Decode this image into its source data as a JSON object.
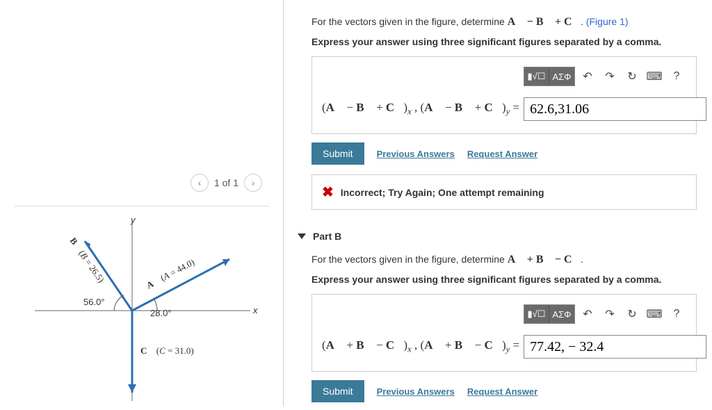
{
  "pager": {
    "label": "1 of 1"
  },
  "figure": {
    "y_label": "y",
    "x_label": "x",
    "angle_left": "56.0°",
    "angle_right": "28.0°",
    "vec_b": "B (B = 26.5)",
    "vec_a": "A (A = 44.0)",
    "vec_c": "C (C = 31.0)",
    "arrow_b": "↗",
    "arrow_a": "↗",
    "arrow_c": "↓",
    "b_prefix": "B⃗",
    "a_prefix": "A⃗",
    "c_prefix": "C⃗"
  },
  "partA": {
    "prompt_pre": "For the vectors given in the figure, determine ",
    "expr": "A⃗ − B⃗ + C⃗",
    "fig_ref": "(Figure 1)",
    "instruction": "Express your answer using three significant figures separated by a comma.",
    "toolbar": {
      "template": "▮√☐",
      "greek": "ΑΣΦ",
      "undo": "↶",
      "redo": "↷",
      "reset": "↻",
      "keyboard": "⌨",
      "help": "?"
    },
    "eq_label": "(A⃗ − B⃗ + C⃗)ₓ , (A⃗ − B⃗ + C⃗)ᵧ = ",
    "value": "62.6,31.06",
    "submit": "Submit",
    "prev": "Previous Answers",
    "req": "Request Answer",
    "feedback": "Incorrect; Try Again; One attempt remaining"
  },
  "partB": {
    "title": "Part B",
    "prompt_pre": "For the vectors given in the figure, determine ",
    "expr": "A⃗ + B⃗ − C⃗",
    "instruction": "Express your answer using three significant figures separated by a comma.",
    "toolbar": {
      "template": "▮√☐",
      "greek": "ΑΣΦ",
      "undo": "↶",
      "redo": "↷",
      "reset": "↻",
      "keyboard": "⌨",
      "help": "?"
    },
    "eq_label": "(A⃗ + B⃗ − C⃗)ₓ , (A⃗ + B⃗ − C⃗)ᵧ = ",
    "value": "77.42, − 32.4",
    "submit": "Submit",
    "prev": "Previous Answers",
    "req": "Request Answer"
  }
}
